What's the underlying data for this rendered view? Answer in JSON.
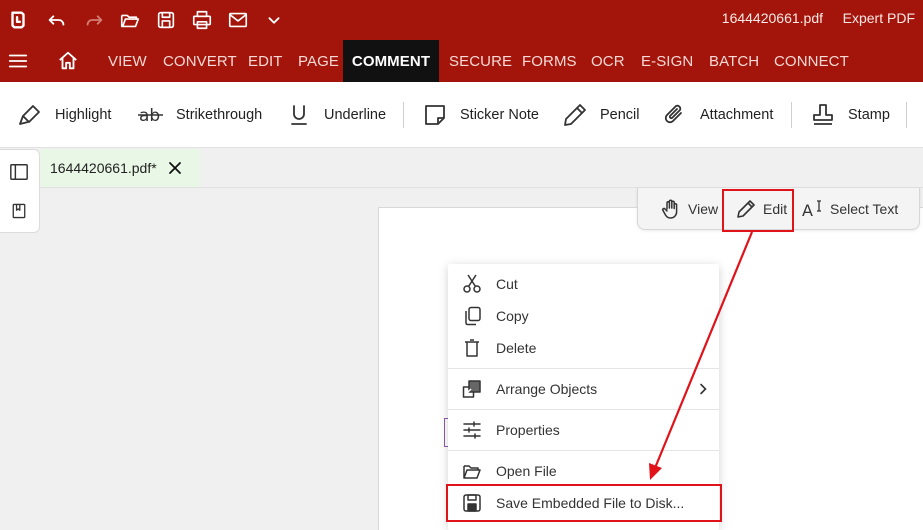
{
  "titlebar": {
    "document_title": "1644420661.pdf",
    "app_name": "Expert PDF"
  },
  "nav": {
    "tabs": [
      {
        "label": "VIEW"
      },
      {
        "label": "CONVERT"
      },
      {
        "label": "EDIT"
      },
      {
        "label": "PAGE"
      },
      {
        "label": "COMMENT",
        "active": true
      },
      {
        "label": "SECURE"
      },
      {
        "label": "FORMS"
      },
      {
        "label": "OCR"
      },
      {
        "label": "E-SIGN"
      },
      {
        "label": "BATCH"
      },
      {
        "label": "CONNECT"
      }
    ]
  },
  "ribbon": {
    "highlight": "Highlight",
    "strikethrough": "Strikethrough",
    "underline": "Underline",
    "sticker_note": "Sticker Note",
    "pencil": "Pencil",
    "attachment": "Attachment",
    "stamp": "Stamp"
  },
  "file_tab": {
    "name": "1644420661.pdf*"
  },
  "mode_toolbar": {
    "view": "View",
    "edit": "Edit",
    "select_text": "Select Text"
  },
  "context_menu": {
    "cut": "Cut",
    "copy": "Copy",
    "delete": "Delete",
    "arrange_objects": "Arrange Objects",
    "properties": "Properties",
    "open_file": "Open File",
    "save_embedded": "Save Embedded File to Disk..."
  },
  "colors": {
    "brand_red": "#a3150a",
    "active_tab": "#111111",
    "annotation_red": "#e0121a",
    "file_tab_bg": "#e9f7e6"
  },
  "icons": [
    "app-logo-icon",
    "undo-icon",
    "redo-icon",
    "open-folder-icon",
    "save-icon",
    "print-icon",
    "mail-icon",
    "chevron-down-icon",
    "hamburger-icon",
    "home-icon",
    "highlighter-icon",
    "strikethrough-icon",
    "underline-icon",
    "sticker-note-icon",
    "pencil-icon",
    "paperclip-icon",
    "stamp-icon",
    "panel-icon",
    "bookmark-icon",
    "close-icon",
    "hand-icon",
    "edit-pencil-icon",
    "select-text-icon",
    "scissors-icon",
    "copy-icon",
    "trash-icon",
    "arrange-icon",
    "properties-icon",
    "open-folder-icon",
    "save-disk-icon",
    "chevron-right-icon"
  ]
}
